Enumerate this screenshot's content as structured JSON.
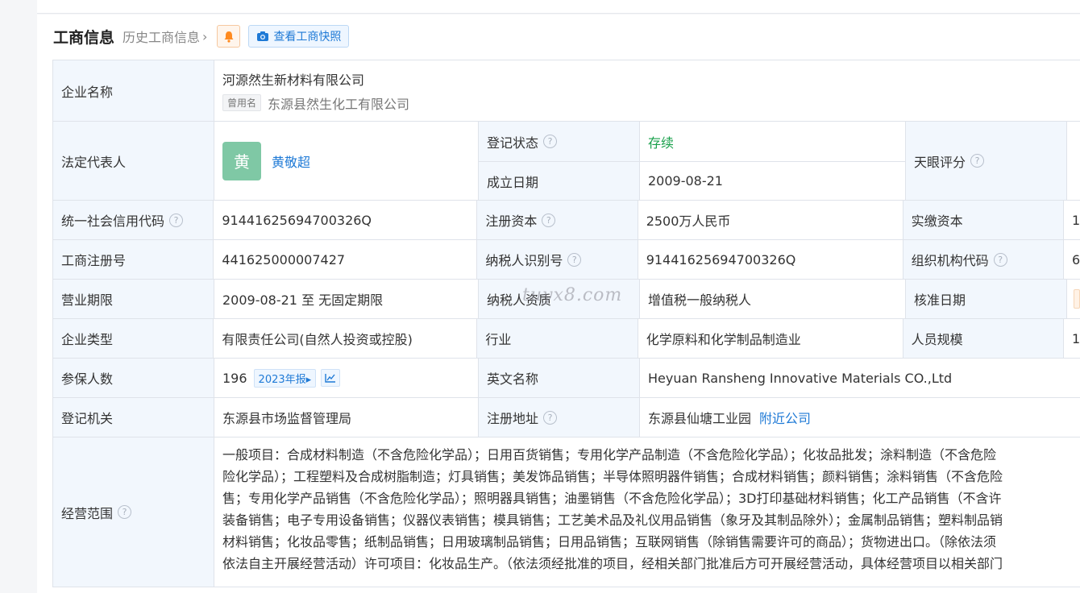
{
  "header": {
    "title": "工商信息",
    "history_label": "历史工商信息",
    "history_chevron": "›",
    "snapshot_label": "查看工商快照"
  },
  "rows": {
    "company_name": {
      "label": "企业名称",
      "value": "河源然生新材料有限公司",
      "used_tag": "曾用名",
      "used_name": "东源县然生化工有限公司"
    },
    "legal_rep": {
      "label": "法定代表人",
      "avatar_char": "黄",
      "name": "黄敬超"
    },
    "reg_status": {
      "label": "登记状态",
      "value": "存续"
    },
    "found_date": {
      "label": "成立日期",
      "value": "2009-08-21"
    },
    "tianyan_score": {
      "label": "天眼评分"
    },
    "credit_code": {
      "label": "统一社会信用代码",
      "value": "91441625694700326Q"
    },
    "reg_capital": {
      "label": "注册资本",
      "value": "2500万人民币"
    },
    "paid_capital": {
      "label": "实缴资本",
      "value": "1"
    },
    "reg_no": {
      "label": "工商注册号",
      "value": "441625000007427"
    },
    "taxpayer_id": {
      "label": "纳税人识别号",
      "value": "91441625694700326Q"
    },
    "org_code": {
      "label": "组织机构代码",
      "value": "6"
    },
    "term": {
      "label": "营业期限",
      "value": "2009-08-21 至 无固定期限"
    },
    "tax_qual": {
      "label": "纳税人资质",
      "value": "增值税一般纳税人"
    },
    "approve_date": {
      "label": "核准日期"
    },
    "company_type": {
      "label": "企业类型",
      "value": "有限责任公司(自然人投资或控股)"
    },
    "industry": {
      "label": "行业",
      "value": "化学原料和化学制品制造业"
    },
    "staff_size": {
      "label": "人员规模",
      "value": "1"
    },
    "insured": {
      "label": "参保人数",
      "value": "196",
      "report_tag": "2023年报▸"
    },
    "english_name": {
      "label": "英文名称",
      "value": "Heyuan Ransheng Innovative Materials CO.,Ltd"
    },
    "reg_authority": {
      "label": "登记机关",
      "value": "东源县市场监督管理局"
    },
    "reg_address": {
      "label": "注册地址",
      "value": "东源县仙塘工业园",
      "nearby": "附近公司"
    },
    "scope": {
      "label": "经营范围",
      "lines": [
        "一般项目：合成材料制造（不含危险化学品）；日用百货销售；专用化学产品制造（不含危险化学品）；化妆品批发；涂料制造（不含危险",
        "险化学品）；工程塑料及合成树脂制造；灯具销售；美发饰品销售；半导体照明器件销售；合成材料销售；颜料销售；涂料销售（不含危险",
        "售；专用化学产品销售（不含危险化学品）；照明器具销售；油墨销售（不含危险化学品）；3D打印基础材料销售；化工产品销售（不含许",
        "装备销售；电子专用设备销售；仪器仪表销售；模具销售；工艺美术品及礼仪用品销售（象牙及其制品除外）；金属制品销售；塑料制品销",
        "材料销售；化妆品零售；纸制品销售；日用玻璃制品销售；日用品销售；互联网销售（除销售需要许可的商品）；货物进出口。（除依法须",
        "依法自主开展经营活动）许可项目：化妆品生产。（依法须经批准的项目，经相关部门批准后方可开展经营活动，具体经营项目以相关部门"
      ]
    }
  },
  "watermark": "tuyx8.com",
  "colors": {
    "label_bg": "#f2f7fd",
    "link": "#1f7ad6",
    "status_green": "#19a04b",
    "avatar_bg": "#7fc8a5"
  }
}
